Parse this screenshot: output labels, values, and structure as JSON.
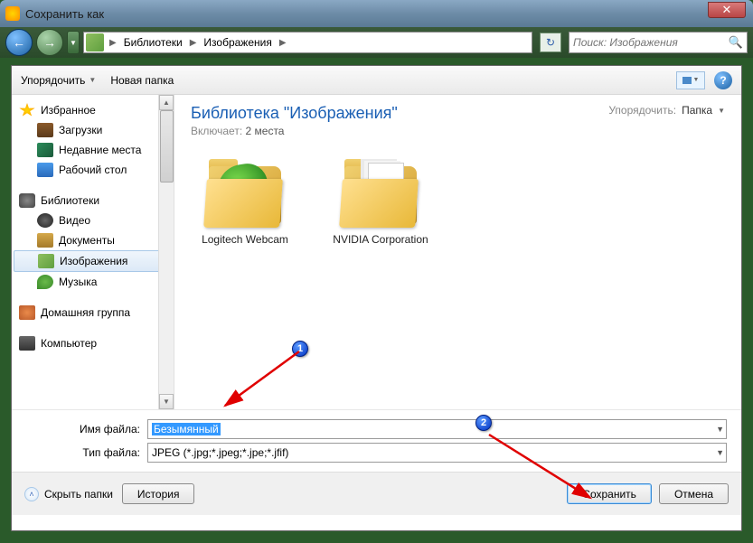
{
  "title": "Сохранить как",
  "breadcrumb": {
    "items": [
      "Библиотеки",
      "Изображения"
    ]
  },
  "search": {
    "placeholder": "Поиск: Изображения"
  },
  "toolbar": {
    "organize": "Упорядочить",
    "newfolder": "Новая папка"
  },
  "sidebar": {
    "favorites": {
      "head": "Избранное",
      "items": [
        "Загрузки",
        "Недавние места",
        "Рабочий стол"
      ]
    },
    "libraries": {
      "head": "Библиотеки",
      "items": [
        "Видео",
        "Документы",
        "Изображения",
        "Музыка"
      ],
      "selected": 2
    },
    "homegroup": "Домашняя группа",
    "computer": "Компьютер"
  },
  "content": {
    "title": "Библиотека \"Изображения\"",
    "includes_label": "Включает:",
    "includes_count": "2 места",
    "arrange_label": "Упорядочить:",
    "arrange_value": "Папка",
    "folders": [
      "Logitech Webcam",
      "NVIDIA Corporation"
    ]
  },
  "fields": {
    "filename_label": "Имя файла:",
    "filename_value": "Безымянный",
    "filetype_label": "Тип файла:",
    "filetype_value": "JPEG (*.jpg;*.jpeg;*.jpe;*.jfif)"
  },
  "bottom": {
    "hide": "Скрыть папки",
    "history": "История",
    "save": "Сохранить",
    "cancel": "Отмена"
  },
  "annotations": {
    "b1": "1",
    "b2": "2"
  }
}
